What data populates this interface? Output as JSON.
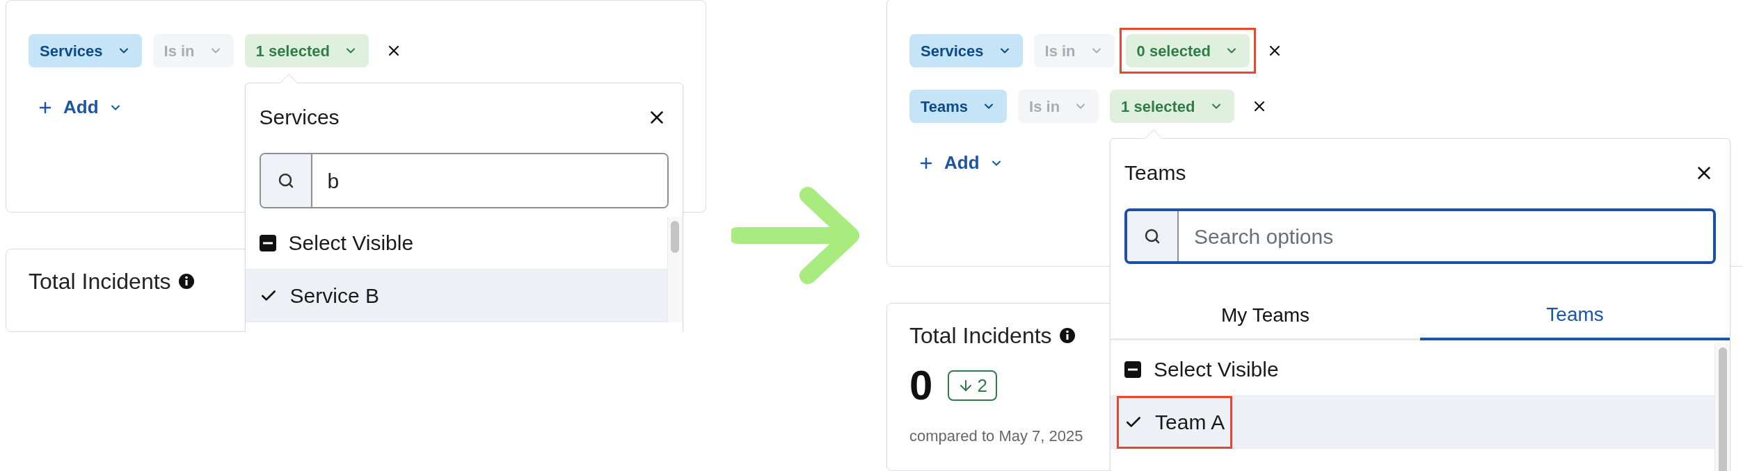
{
  "panels": [
    {
      "filters": [
        {
          "field": "Services",
          "operator": "Is in",
          "value": "1 selected",
          "highlighted": false,
          "popover": {
            "title": "Services",
            "search": {
              "value": "b",
              "focused": false
            },
            "options": [
              {
                "kind": "select_visible",
                "label": "Select Visible",
                "selected": false,
                "highlighted": false
              },
              {
                "kind": "option",
                "label": "Service B",
                "selected": true,
                "highlighted": false
              }
            ]
          }
        }
      ],
      "add_button": "Add",
      "metric": {
        "title": "Total Incidents"
      }
    },
    {
      "filters": [
        {
          "field": "Services",
          "operator": "Is in",
          "value": "0 selected",
          "highlighted": true
        },
        {
          "field": "Teams",
          "operator": "Is in",
          "value": "1 selected",
          "highlighted": false,
          "popover": {
            "title": "Teams",
            "search": {
              "placeholder": "Search options",
              "focused": true
            },
            "tabs": [
              {
                "label": "My Teams",
                "selected": false
              },
              {
                "label": "Teams",
                "selected": true
              }
            ],
            "options": [
              {
                "kind": "select_visible",
                "label": "Select Visible",
                "selected": false,
                "highlighted": false
              },
              {
                "kind": "option",
                "label": "Team A",
                "selected": true,
                "highlighted": true
              }
            ]
          }
        }
      ],
      "add_button": "Add",
      "metric": {
        "title": "Total Incidents",
        "value": "0",
        "change": "2",
        "comparison": "compared to May 7, 2025"
      }
    }
  ]
}
